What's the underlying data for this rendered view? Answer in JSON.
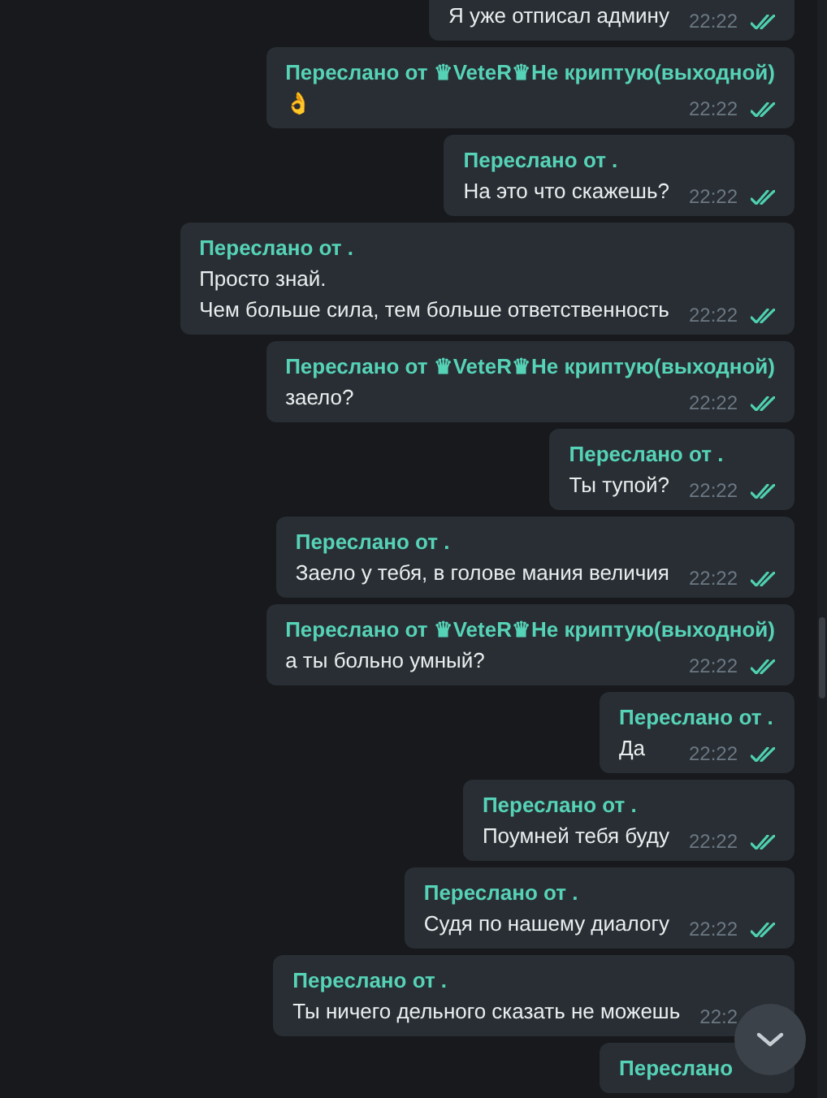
{
  "messages": [
    {
      "lines": [
        "Я уже отписал админу"
      ],
      "time": "22:22",
      "read": true
    },
    {
      "forwarded_from": "Переслано от ♛VeteR♛Не криптую(выходной)",
      "lines": [
        "👌"
      ],
      "time": "22:22",
      "read": true
    },
    {
      "forwarded_from": "Переслано от .",
      "lines": [
        "На это что скажешь?"
      ],
      "time": "22:22",
      "read": true
    },
    {
      "forwarded_from": "Переслано от .",
      "lines": [
        "Просто знай.",
        "Чем больше сила, тем больше ответственность"
      ],
      "time": "22:22",
      "read": true
    },
    {
      "forwarded_from": "Переслано от ♛VeteR♛Не криптую(выходной)",
      "lines": [
        "заело?"
      ],
      "time": "22:22",
      "read": true
    },
    {
      "forwarded_from": "Переслано от .",
      "lines": [
        "Ты тупой?"
      ],
      "time": "22:22",
      "read": true
    },
    {
      "forwarded_from": "Переслано от .",
      "lines": [
        "Заело у тебя, в голове мания величия"
      ],
      "time": "22:22",
      "read": true
    },
    {
      "forwarded_from": "Переслано от ♛VeteR♛Не криптую(выходной)",
      "lines": [
        "а ты больно умный?"
      ],
      "time": "22:22",
      "read": true
    },
    {
      "forwarded_from": "Переслано от .",
      "lines": [
        "Да"
      ],
      "time": "22:22",
      "read": true
    },
    {
      "forwarded_from": "Переслано от .",
      "lines": [
        "Поумней тебя буду"
      ],
      "time": "22:22",
      "read": true
    },
    {
      "forwarded_from": "Переслано от .",
      "lines": [
        "Судя по нашему диалогу"
      ],
      "time": "22:22",
      "read": true
    },
    {
      "forwarded_from": "Переслано от .",
      "lines": [
        "Ты ничего дельного сказать не можешь"
      ],
      "time": "22:2"
    },
    {
      "forwarded_from": "Переслано"
    }
  ]
}
